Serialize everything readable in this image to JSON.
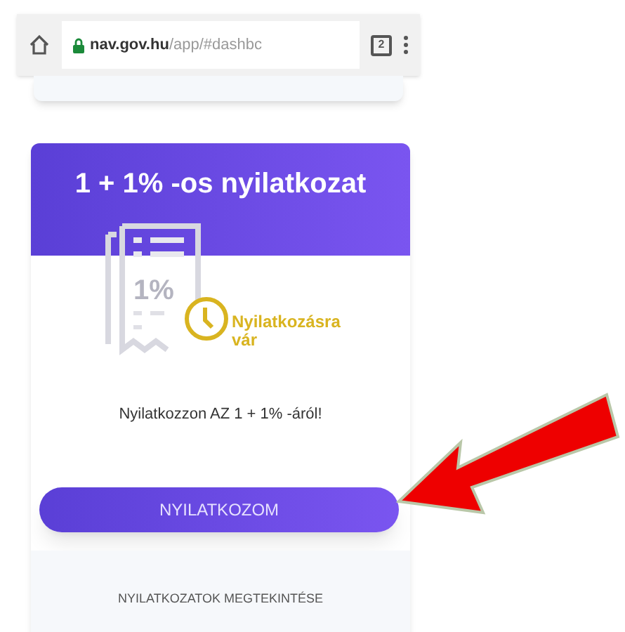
{
  "browser": {
    "url_host": "nav.gov.hu",
    "url_path": "/app/#dashbc",
    "tab_count": "2"
  },
  "card": {
    "title": "1 + 1% -os nyilatkozat",
    "icon_text": "1%",
    "status": "Nyilatkozásra vár",
    "prompt": "Nyilatkozzon AZ 1 + 1% -áról!",
    "button": "NYILATKOZOM",
    "footer_link": "NYILATKOZATOK MEGTEKINTÉSE"
  }
}
